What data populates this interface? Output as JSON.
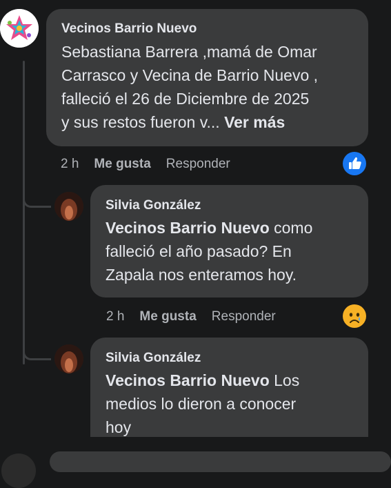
{
  "comments": [
    {
      "author": "Vecinos Barrio Nuevo",
      "lines": [
        "Sebastiana Barrera ,mamá de Omar",
        "Carrasco y Vecina de Barrio Nuevo ,",
        "falleció el 26 de Diciembre de 2025",
        "y sus restos fueron v..."
      ],
      "see_more": "Ver más",
      "time": "2 h",
      "like": "Me gusta",
      "reply": "Responder",
      "reaction_icon": "like-reaction-icon",
      "reaction_color": "#1877f2"
    },
    {
      "author": "Silvia González",
      "mention": "Vecinos Barrio Nuevo",
      "line1_rest": " como",
      "lines": [
        "falleció el año pasado? En",
        "Zapala nos enteramos hoy."
      ],
      "time": "2 h",
      "like": "Me gusta",
      "reply": "Responder",
      "reaction_icon": "sad-reaction-icon",
      "reaction_color": "#f7b125"
    },
    {
      "author": "Silvia González",
      "mention": "Vecinos Barrio Nuevo",
      "line1_rest": " Los",
      "lines": [
        "medios lo dieron a conocer",
        "hoy"
      ]
    }
  ]
}
